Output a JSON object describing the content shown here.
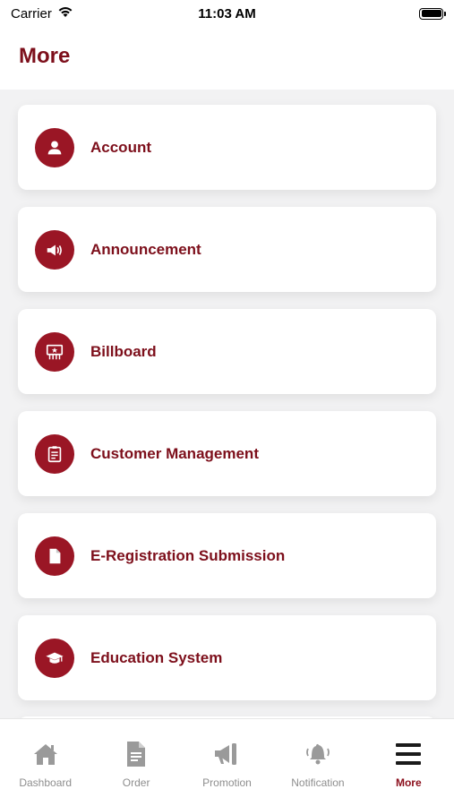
{
  "status_bar": {
    "carrier": "Carrier",
    "time": "11:03 AM"
  },
  "header": {
    "title": "More"
  },
  "menu": {
    "items": [
      {
        "label": "Account",
        "icon": "person-icon"
      },
      {
        "label": "Announcement",
        "icon": "megaphone-icon"
      },
      {
        "label": "Billboard",
        "icon": "billboard-icon"
      },
      {
        "label": "Customer Management",
        "icon": "clipboard-icon"
      },
      {
        "label": "E-Registration Submission",
        "icon": "document-icon"
      },
      {
        "label": "Education System",
        "icon": "graduation-cap-icon"
      }
    ]
  },
  "tab_bar": {
    "tabs": [
      {
        "label": "Dashboard",
        "icon": "home-icon",
        "active": false
      },
      {
        "label": "Order",
        "icon": "document-icon",
        "active": false
      },
      {
        "label": "Promotion",
        "icon": "megaphone-icon",
        "active": false
      },
      {
        "label": "Notification",
        "icon": "bell-icon",
        "active": false
      },
      {
        "label": "More",
        "icon": "menu-icon",
        "active": true
      }
    ]
  },
  "colors": {
    "accent": "#9a1625",
    "title": "#7d0f1b",
    "inactive_tab": "#8e8e8e",
    "background": "#f2f2f3"
  }
}
